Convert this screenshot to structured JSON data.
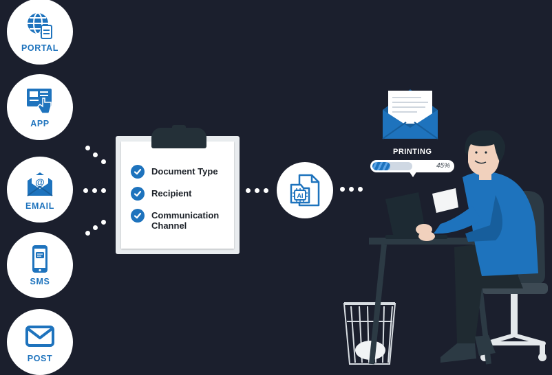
{
  "channels": [
    {
      "label": "PORTAL",
      "icon": "globe-document-icon"
    },
    {
      "label": "APP",
      "icon": "tap-screen-icon"
    },
    {
      "label": "EMAIL",
      "icon": "email-envelope-icon"
    },
    {
      "label": "SMS",
      "icon": "phone-message-icon"
    },
    {
      "label": "POST",
      "icon": "envelope-icon"
    }
  ],
  "checklist": {
    "items": [
      {
        "text": "Document Type"
      },
      {
        "text": "Recipient"
      },
      {
        "text": "Communication Channel"
      }
    ]
  },
  "processor": {
    "icon": "ai-document-icon"
  },
  "output": {
    "status": "PRINTING",
    "progress_text": "45%",
    "progress": 0.45
  },
  "colors": {
    "background": "#1b1f2d",
    "accent": "#1e73bd",
    "dark": "#243038"
  }
}
